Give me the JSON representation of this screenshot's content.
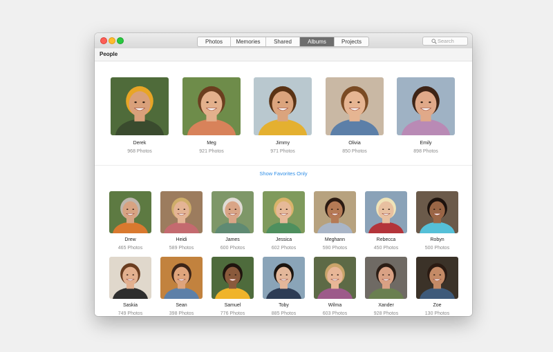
{
  "toolbar": {
    "tabs": [
      "Photos",
      "Memories",
      "Shared",
      "Albums",
      "Projects"
    ],
    "active_tab": "Albums",
    "search_placeholder": "Search"
  },
  "section": {
    "title": "People"
  },
  "favorites": [
    {
      "name": "Derek",
      "count": "968 Photos"
    },
    {
      "name": "Meg",
      "count": "921 Photos"
    },
    {
      "name": "Jimmy",
      "count": "971 Photos"
    },
    {
      "name": "Olivia",
      "count": "850 Photos"
    },
    {
      "name": "Emily",
      "count": "898 Photos"
    }
  ],
  "show_favorites_label": "Show Favorites Only",
  "others": [
    {
      "name": "Drew",
      "count": "465 Photos"
    },
    {
      "name": "Heidi",
      "count": "589 Photos"
    },
    {
      "name": "James",
      "count": "600 Photos"
    },
    {
      "name": "Jessica",
      "count": "602 Photos"
    },
    {
      "name": "Meghann",
      "count": "590 Photos"
    },
    {
      "name": "Rebecca",
      "count": "450 Photos"
    },
    {
      "name": "Robyn",
      "count": "500 Photos"
    },
    {
      "name": "Saskia",
      "count": "749 Photos"
    },
    {
      "name": "Sean",
      "count": "398 Photos"
    },
    {
      "name": "Samuel",
      "count": "776 Photos"
    },
    {
      "name": "Toby",
      "count": "885 Photos"
    },
    {
      "name": "Wilma",
      "count": "603 Photos"
    },
    {
      "name": "Xander",
      "count": "928 Photos"
    },
    {
      "name": "Zoe",
      "count": "130 Photos"
    }
  ],
  "colors": {
    "accent_link": "#2f8ee6",
    "active_tab": "#6e6e6e"
  }
}
